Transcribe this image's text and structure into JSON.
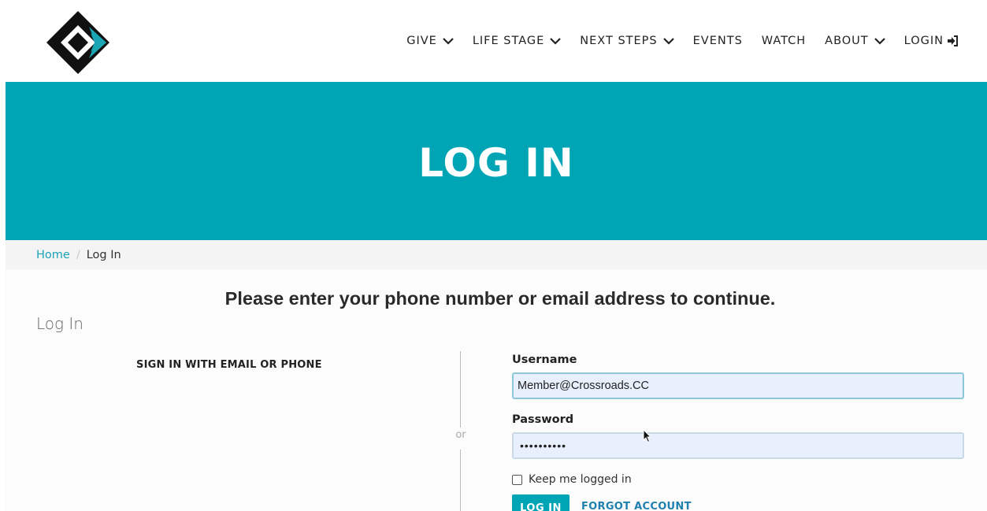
{
  "header": {
    "nav": [
      {
        "label": "GIVE",
        "has_dropdown": true
      },
      {
        "label": "LIFE STAGE",
        "has_dropdown": true
      },
      {
        "label": "NEXT STEPS",
        "has_dropdown": true
      },
      {
        "label": "EVENTS",
        "has_dropdown": false
      },
      {
        "label": "WATCH",
        "has_dropdown": false
      },
      {
        "label": "ABOUT",
        "has_dropdown": true
      },
      {
        "label": "LOGIN",
        "has_dropdown": false,
        "icon": "sign-in-icon"
      }
    ]
  },
  "hero": {
    "title": "LOG IN",
    "background": "#00a5b5"
  },
  "breadcrumb": {
    "home": "Home",
    "separator": "/",
    "current": "Log In"
  },
  "main": {
    "prompt": "Please enter your phone number or email address to continue.",
    "section_title": "Log In",
    "left_title": "SIGN IN WITH EMAIL OR PHONE",
    "or_text": "or",
    "form": {
      "username_label": "Username",
      "username_value": "Member@Crossroads.CC",
      "password_label": "Password",
      "password_value": "••••••••••",
      "keep_logged_in": "Keep me logged in",
      "login_button": "LOG IN",
      "forgot_link": "FORGOT ACCOUNT"
    }
  },
  "colors": {
    "accent": "#00a5b5",
    "link": "#1aa2b6",
    "forgot_link": "#1f7fae"
  }
}
